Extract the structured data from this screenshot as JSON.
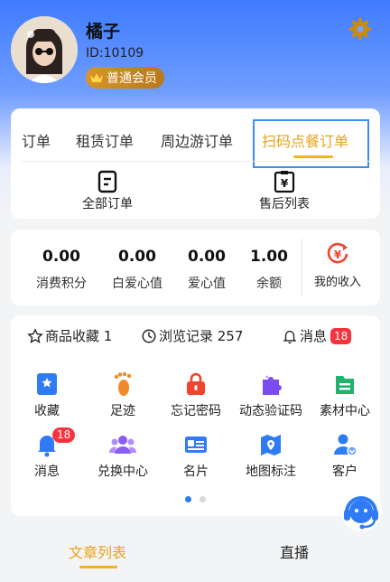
{
  "profile": {
    "name": "橘子",
    "id": "ID:10109",
    "member_level": "普通会员",
    "avatar": "avatar-photo",
    "settings_icon": "gear-icon"
  },
  "orders": {
    "tabs": [
      "订单",
      "租赁订单",
      "周边游订单",
      "扫码点餐订单"
    ],
    "active_tab": "扫码点餐订单",
    "sub_items": [
      {
        "label": "全部订单",
        "icon": "order-list-icon"
      },
      {
        "label": "售后列表",
        "icon": "after-sales-icon"
      }
    ]
  },
  "stats": [
    {
      "value": "0.00",
      "label": "消费积分"
    },
    {
      "value": "0.00",
      "label": "白爱心值"
    },
    {
      "value": "0.00",
      "label": "爱心值"
    },
    {
      "value": "1.00",
      "label": "余额"
    }
  ],
  "income": {
    "label": "我的收入",
    "icon": "income-icon"
  },
  "tools_header": {
    "favorites": "商品收藏 1",
    "history": "浏览记录 257",
    "messages": "消息",
    "messages_count": "18"
  },
  "tools": [
    {
      "label": "收藏",
      "icon": "favorite-icon",
      "color": "#2f7bf5"
    },
    {
      "label": "足迹",
      "icon": "footprint-icon",
      "color": "#f08a2a"
    },
    {
      "label": "忘记密码",
      "icon": "lock-icon",
      "color": "#f0442e"
    },
    {
      "label": "动态验证码",
      "icon": "puzzle-icon",
      "color": "#7b4cf2"
    },
    {
      "label": "素材中心",
      "icon": "folder-icon",
      "color": "#22b26b"
    },
    {
      "label": "消息",
      "icon": "bell-icon",
      "color": "#2f7bf5",
      "badge": "18"
    },
    {
      "label": "兑换中心",
      "icon": "group-icon",
      "color": "#8a5cf5"
    },
    {
      "label": "名片",
      "icon": "card-icon",
      "color": "#2f7bf5"
    },
    {
      "label": "地图标注",
      "icon": "map-icon",
      "color": "#2f7bf5"
    },
    {
      "label": "客户",
      "icon": "customer-icon",
      "color": "#2f7bf5"
    }
  ],
  "pager": {
    "pages": 2,
    "current": 1
  },
  "bottom_tabs": [
    "文章列表",
    "直播"
  ],
  "active_bottom_tab": "文章列表",
  "colors": {
    "accent": "#e9a31b",
    "primary": "#3f7bff",
    "badge": "#f4333c"
  }
}
